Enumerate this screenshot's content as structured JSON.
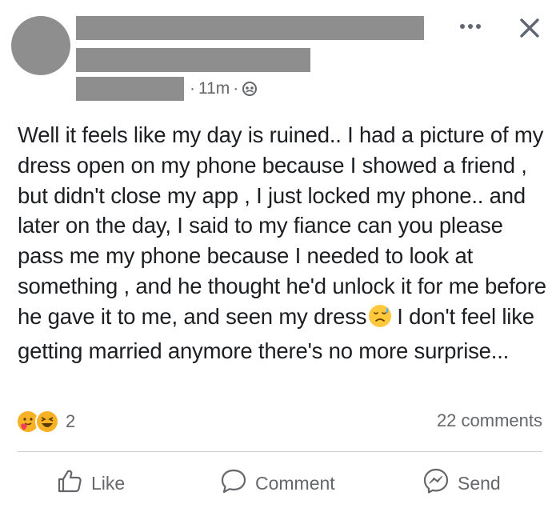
{
  "post": {
    "time": "11m",
    "separator": "·",
    "privacy_icon": "friends-icon",
    "body_before_emoji": "Well it feels like my day is ruined.. I had a picture of my dress open on my phone because I showed a friend , but didn't close my app , I just locked my phone.. and later on the day,  I said to my fiance can you please pass me my phone because I needed to look at something , and he thought he'd unlock it for me before he gave it to me, and seen my dress",
    "inline_emoji": "sad-relieved-emoji",
    "body_after_emoji": "I don't feel like getting married anymore there's no more surprise..."
  },
  "header": {
    "more_icon": "more-options-icon",
    "close_icon": "close-icon"
  },
  "reactions": {
    "icons": [
      "care-reaction-icon",
      "haha-reaction-icon"
    ],
    "count": "2"
  },
  "comments": {
    "label": "22 comments"
  },
  "actions": {
    "like": "Like",
    "comment": "Comment",
    "send": "Send"
  },
  "colors": {
    "redaction": "#8e8e8e",
    "secondary_text": "#65676b",
    "reaction_yellow": "#f7b125",
    "care_red": "#f33e58"
  }
}
